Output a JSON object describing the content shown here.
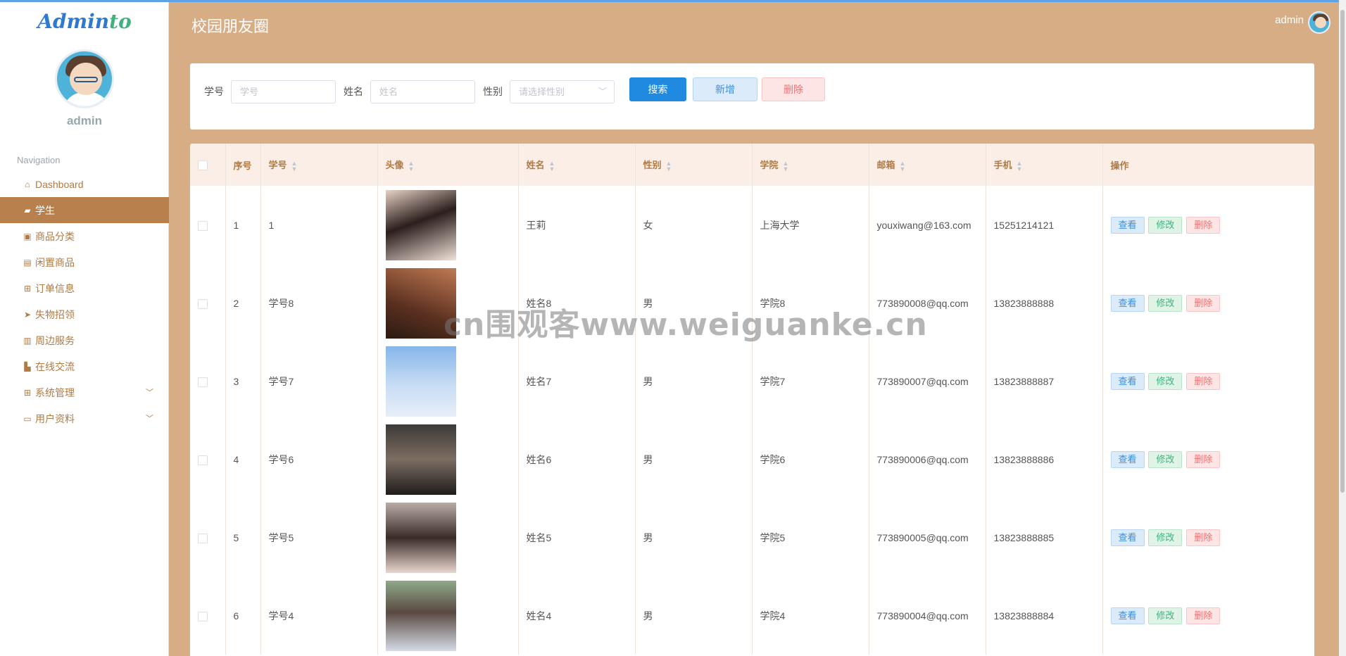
{
  "sidebar": {
    "logo_part1": "Admin",
    "logo_part2": "to",
    "user_name": "admin",
    "nav_title": "Navigation",
    "items": [
      {
        "label": "Dashboard",
        "icon": "home-icon"
      },
      {
        "label": "学生",
        "icon": "chat-icon",
        "active": true
      },
      {
        "label": "商品分类",
        "icon": "briefcase-icon"
      },
      {
        "label": "闲置商品",
        "icon": "clipboard-icon"
      },
      {
        "label": "订单信息",
        "icon": "grid-icon"
      },
      {
        "label": "失物招领",
        "icon": "send-icon"
      },
      {
        "label": "周边服务",
        "icon": "clipboard-check-icon"
      },
      {
        "label": "在线交流",
        "icon": "thumbs-up-icon"
      },
      {
        "label": "系统管理",
        "icon": "grid-icon",
        "expandable": true
      },
      {
        "label": "用户资料",
        "icon": "card-icon",
        "expandable": true
      }
    ]
  },
  "header": {
    "title": "校园朋友圈",
    "user": "admin"
  },
  "search": {
    "student_id_label": "学号",
    "student_id_placeholder": "学号",
    "name_label": "姓名",
    "name_placeholder": "姓名",
    "gender_label": "性别",
    "gender_placeholder": "请选择性别",
    "search_btn": "搜索",
    "add_btn": "新增",
    "delete_btn": "删除"
  },
  "table": {
    "headers": {
      "index": "序号",
      "student_id": "学号",
      "avatar": "头像",
      "name": "姓名",
      "gender": "性别",
      "college": "学院",
      "email": "邮箱",
      "phone": "手机",
      "actions": "操作"
    },
    "action_labels": {
      "view": "查看",
      "edit": "修改",
      "delete": "删除"
    },
    "rows": [
      {
        "index": "1",
        "student_id": "1",
        "name": "王莉",
        "gender": "女",
        "college": "上海大学",
        "email": "youxiwang@163.com",
        "phone": "15251214121"
      },
      {
        "index": "2",
        "student_id": "学号8",
        "name": "姓名8",
        "gender": "男",
        "college": "学院8",
        "email": "773890008@qq.com",
        "phone": "13823888888"
      },
      {
        "index": "3",
        "student_id": "学号7",
        "name": "姓名7",
        "gender": "男",
        "college": "学院7",
        "email": "773890007@qq.com",
        "phone": "13823888887"
      },
      {
        "index": "4",
        "student_id": "学号6",
        "name": "姓名6",
        "gender": "男",
        "college": "学院6",
        "email": "773890006@qq.com",
        "phone": "13823888886"
      },
      {
        "index": "5",
        "student_id": "学号5",
        "name": "姓名5",
        "gender": "男",
        "college": "学院5",
        "email": "773890005@qq.com",
        "phone": "13823888885"
      },
      {
        "index": "6",
        "student_id": "学号4",
        "name": "姓名4",
        "gender": "男",
        "college": "学院4",
        "email": "773890004@qq.com",
        "phone": "13823888884"
      }
    ]
  },
  "watermark": "cn围观客www.weiguanke.cn",
  "colors": {
    "background": "#d6ad85",
    "accent": "#b8804d",
    "primary": "#1f8ae0",
    "danger": "#f07070",
    "success": "#3fb27f"
  }
}
